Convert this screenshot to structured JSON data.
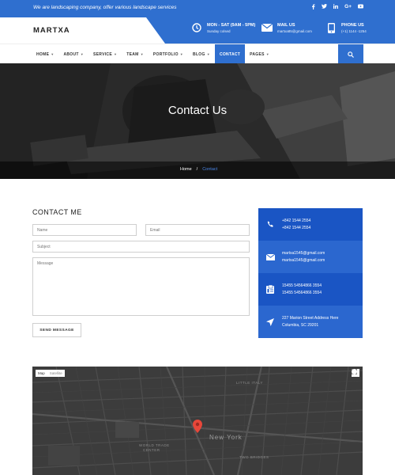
{
  "topbar": {
    "tagline": "We are landscaping company, offer various landscape services",
    "socials": [
      "facebook-icon",
      "twitter-icon",
      "linkedin-icon",
      "google-plus-icon",
      "youtube-icon"
    ]
  },
  "header": {
    "logo": "MARTXA",
    "hours": {
      "title": "MON - SAT (9AM - 5PM)",
      "sub": "Sunday colsed"
    },
    "mail": {
      "title": "MAIL US",
      "sub": "martxa85@gmail.com"
    },
    "phone": {
      "title": "PHONE US",
      "sub": "(+1) 1144 -1254"
    }
  },
  "nav": {
    "items": [
      {
        "label": "HOME",
        "caret": true
      },
      {
        "label": "ABOUT",
        "caret": true
      },
      {
        "label": "SERVICE",
        "caret": true
      },
      {
        "label": "TEAM",
        "caret": true
      },
      {
        "label": "PORTFOLIO",
        "caret": true
      },
      {
        "label": "BLOG",
        "caret": true
      },
      {
        "label": "CONTACT",
        "caret": false,
        "active": true
      },
      {
        "label": "PAGES",
        "caret": true
      }
    ]
  },
  "hero": {
    "title": "Contact Us",
    "breadcrumb": {
      "home": "Home",
      "separator": "/",
      "current": "Contact"
    }
  },
  "form": {
    "title": "CONTACT ME",
    "name_placeholder": "Name",
    "email_placeholder": "Email",
    "subject_placeholder": "Subject",
    "message_placeholder": "Message",
    "send_label": "SEND MESSAGE"
  },
  "panel": {
    "colors": [
      "#1a55c4",
      "#2b67cf",
      "#1a55c4",
      "#2b67cf"
    ],
    "phone": [
      "+842 1544 2554",
      "+842 1544 2554"
    ],
    "email": [
      "martxa1545@gmail.com",
      "martxa1545@gmail.com"
    ],
    "fax": [
      "15455 54564866 3554",
      "15455 54564866 3554"
    ],
    "address": [
      "227 Marion Street Address Here",
      "Columbia, SC 29201"
    ]
  },
  "map": {
    "type_map": "Map",
    "type_satellite": "Satellite",
    "city": "New York",
    "labels": {
      "little_italy": "LITTLE ITALY",
      "trade_center": "WORLD TRADE",
      "trade_center2": "CENTER",
      "two_bridges": "TWO BRIDGES"
    }
  },
  "colors": {
    "accent": "#2f6fcf",
    "panel_dark": "#1a55c4",
    "panel_light": "#2b67cf"
  }
}
